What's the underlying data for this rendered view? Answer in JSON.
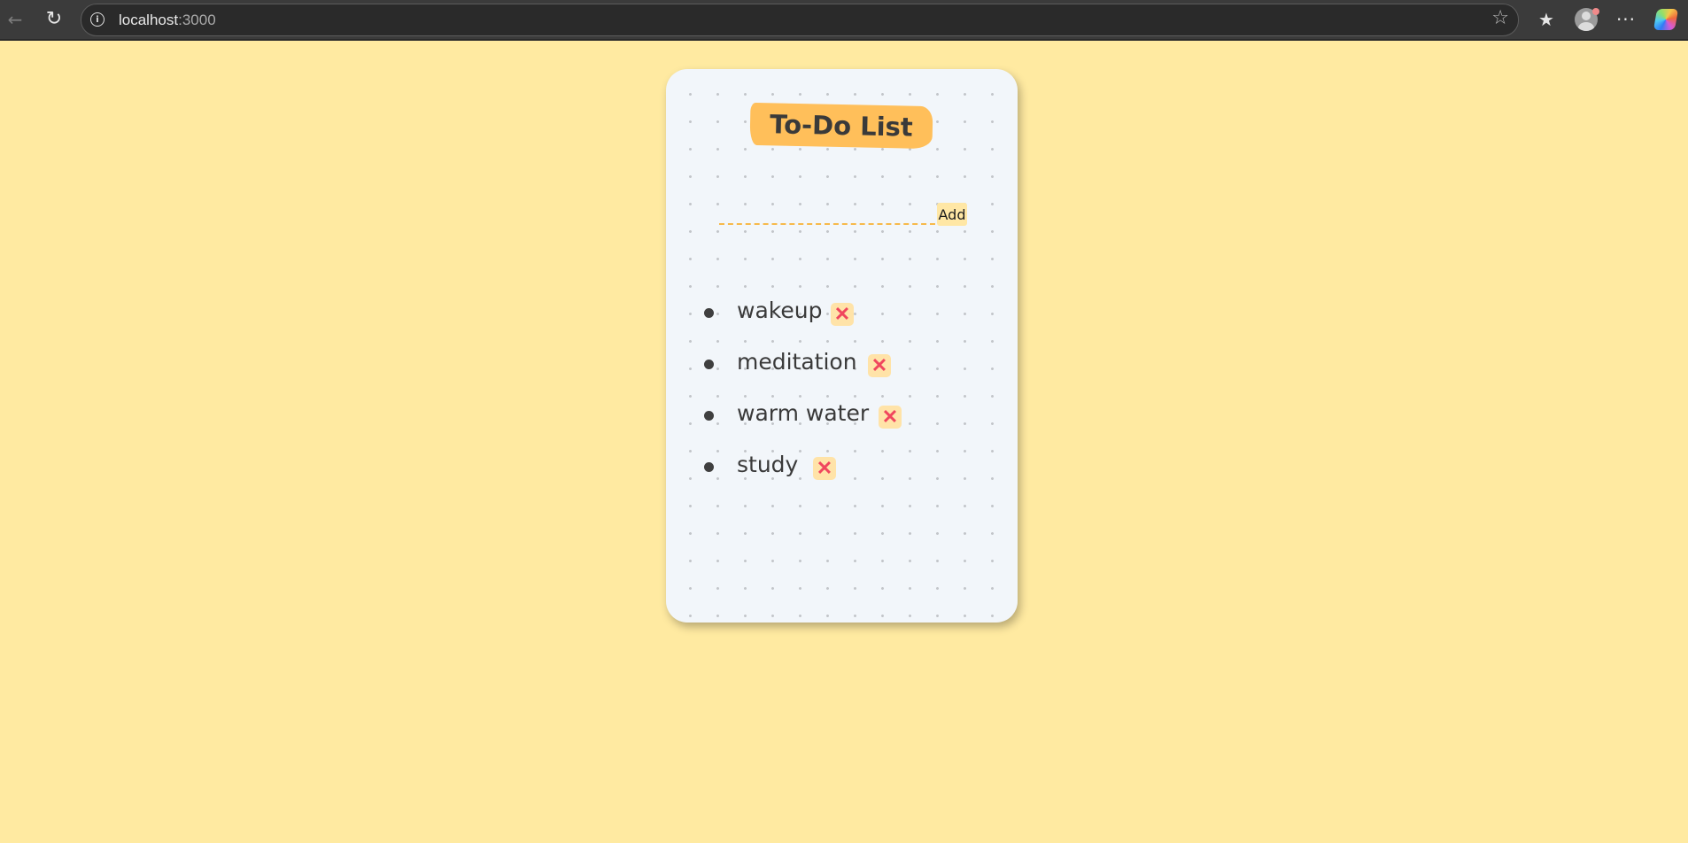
{
  "browser": {
    "url_host": "localhost",
    "url_port": ":3000",
    "icons": {
      "back": "back-arrow-icon",
      "reload": "reload-icon",
      "info": "site-info-icon",
      "star": "star-icon",
      "favorites": "favorites-icon",
      "profile": "profile-avatar-icon",
      "more": "more-icon",
      "copilot": "copilot-icon"
    }
  },
  "app": {
    "title": "To-Do List",
    "input": {
      "value": "",
      "placeholder": ""
    },
    "add_label": "Add",
    "delete_symbol": "✕",
    "items": [
      {
        "text": "wakeup"
      },
      {
        "text": "meditation"
      },
      {
        "text": "warm water"
      },
      {
        "text": "study"
      }
    ]
  },
  "colors": {
    "page_background": "#ffeaa1",
    "card_background": "#f2f6fa",
    "title_background": "#ffbf5a",
    "button_background": "#ffe7a5",
    "delete_color": "#f0465e",
    "input_underline": "#f7b94a"
  }
}
